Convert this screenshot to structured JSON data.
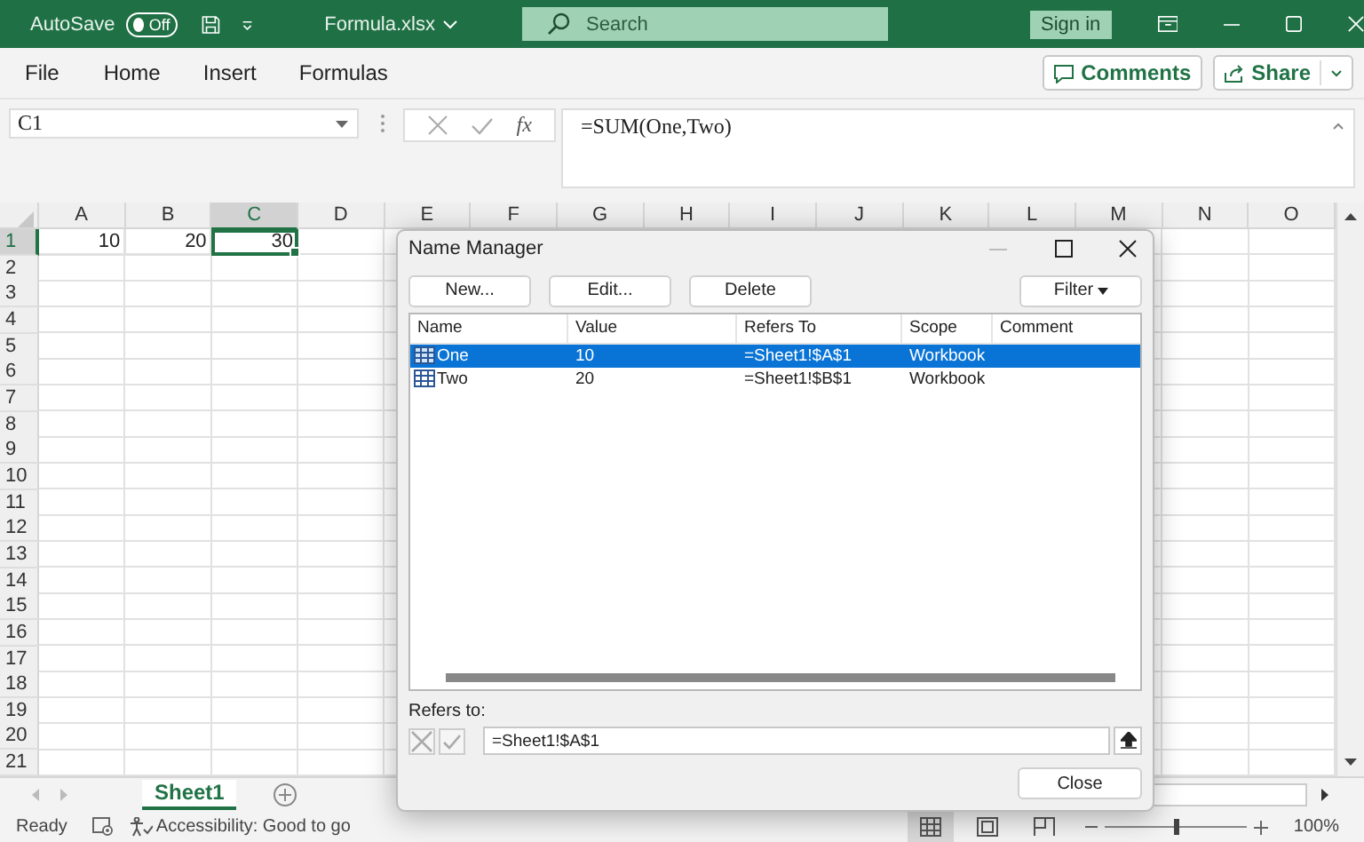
{
  "titlebar": {
    "autosave_label": "AutoSave",
    "autosave_toggle": {
      "label": "Off",
      "on": false
    },
    "filename": "Formula.xlsx",
    "search": {
      "placeholder": "Search"
    },
    "sign_in": "Sign in"
  },
  "menu": [
    "File",
    "Home",
    "Insert",
    "Formulas"
  ],
  "actions": {
    "comments": "Comments",
    "share": "Share"
  },
  "formula_bar": {
    "name_box": "C1",
    "fx": "fx",
    "formula": "=SUM(One,Two)"
  },
  "sheet": {
    "columns": [
      {
        "label": "A",
        "selected": false
      },
      {
        "label": "B",
        "selected": false
      },
      {
        "label": "C",
        "selected": true
      },
      {
        "label": "D",
        "selected": false
      },
      {
        "label": "E",
        "selected": false
      },
      {
        "label": "F",
        "selected": false
      },
      {
        "label": "G",
        "selected": false
      },
      {
        "label": "H",
        "selected": false
      },
      {
        "label": "I",
        "selected": false
      },
      {
        "label": "J",
        "selected": false
      },
      {
        "label": "K",
        "selected": false
      },
      {
        "label": "L",
        "selected": false
      },
      {
        "label": "M",
        "selected": false
      },
      {
        "label": "N",
        "selected": false
      },
      {
        "label": "O",
        "selected": false
      }
    ],
    "rows": [
      {
        "label": "1",
        "selected": true,
        "cells": [
          {
            "value": "10",
            "selected": false
          },
          {
            "value": "20",
            "selected": false
          },
          {
            "value": "30",
            "selected": true
          }
        ]
      },
      {
        "label": "2",
        "selected": false
      },
      {
        "label": "3",
        "selected": false
      },
      {
        "label": "4",
        "selected": false
      },
      {
        "label": "5",
        "selected": false
      },
      {
        "label": "6",
        "selected": false
      },
      {
        "label": "7",
        "selected": false
      },
      {
        "label": "8",
        "selected": false
      },
      {
        "label": "9",
        "selected": false
      },
      {
        "label": "10",
        "selected": false
      },
      {
        "label": "11",
        "selected": false
      },
      {
        "label": "12",
        "selected": false
      },
      {
        "label": "13",
        "selected": false
      },
      {
        "label": "14",
        "selected": false
      },
      {
        "label": "15",
        "selected": false
      },
      {
        "label": "16",
        "selected": false
      },
      {
        "label": "17",
        "selected": false
      },
      {
        "label": "18",
        "selected": false
      },
      {
        "label": "19",
        "selected": false
      },
      {
        "label": "20",
        "selected": false
      },
      {
        "label": "21",
        "selected": false
      }
    ]
  },
  "sheet_tabs": [
    {
      "label": "Sheet1",
      "selected": true
    }
  ],
  "status_bar": {
    "status": "Ready",
    "accessibility": "Accessibility: Good to go",
    "views": [
      {
        "kind": "normal",
        "selected": true
      },
      {
        "kind": "page_layout",
        "selected": false
      },
      {
        "kind": "page_break",
        "selected": false
      }
    ],
    "zoom_slider": {
      "level": 0.5
    },
    "zoom": "100%"
  },
  "dialog": {
    "title": "Name Manager",
    "buttons": [
      "New...",
      "Edit...",
      "Delete"
    ],
    "filter": "Filter",
    "columns": [
      "Name",
      "Value",
      "Refers To",
      "Scope",
      "Comment"
    ],
    "rows": [
      {
        "name": "One",
        "value": "10",
        "refers_to": "=Sheet1!$A$1",
        "scope": "Workbook",
        "selected": true
      },
      {
        "name": "Two",
        "value": "20",
        "refers_to": "=Sheet1!$B$1",
        "scope": "Workbook",
        "selected": false
      }
    ],
    "refers_label": "Refers to:",
    "refers_value": "=Sheet1!$A$1",
    "close": "Close"
  }
}
